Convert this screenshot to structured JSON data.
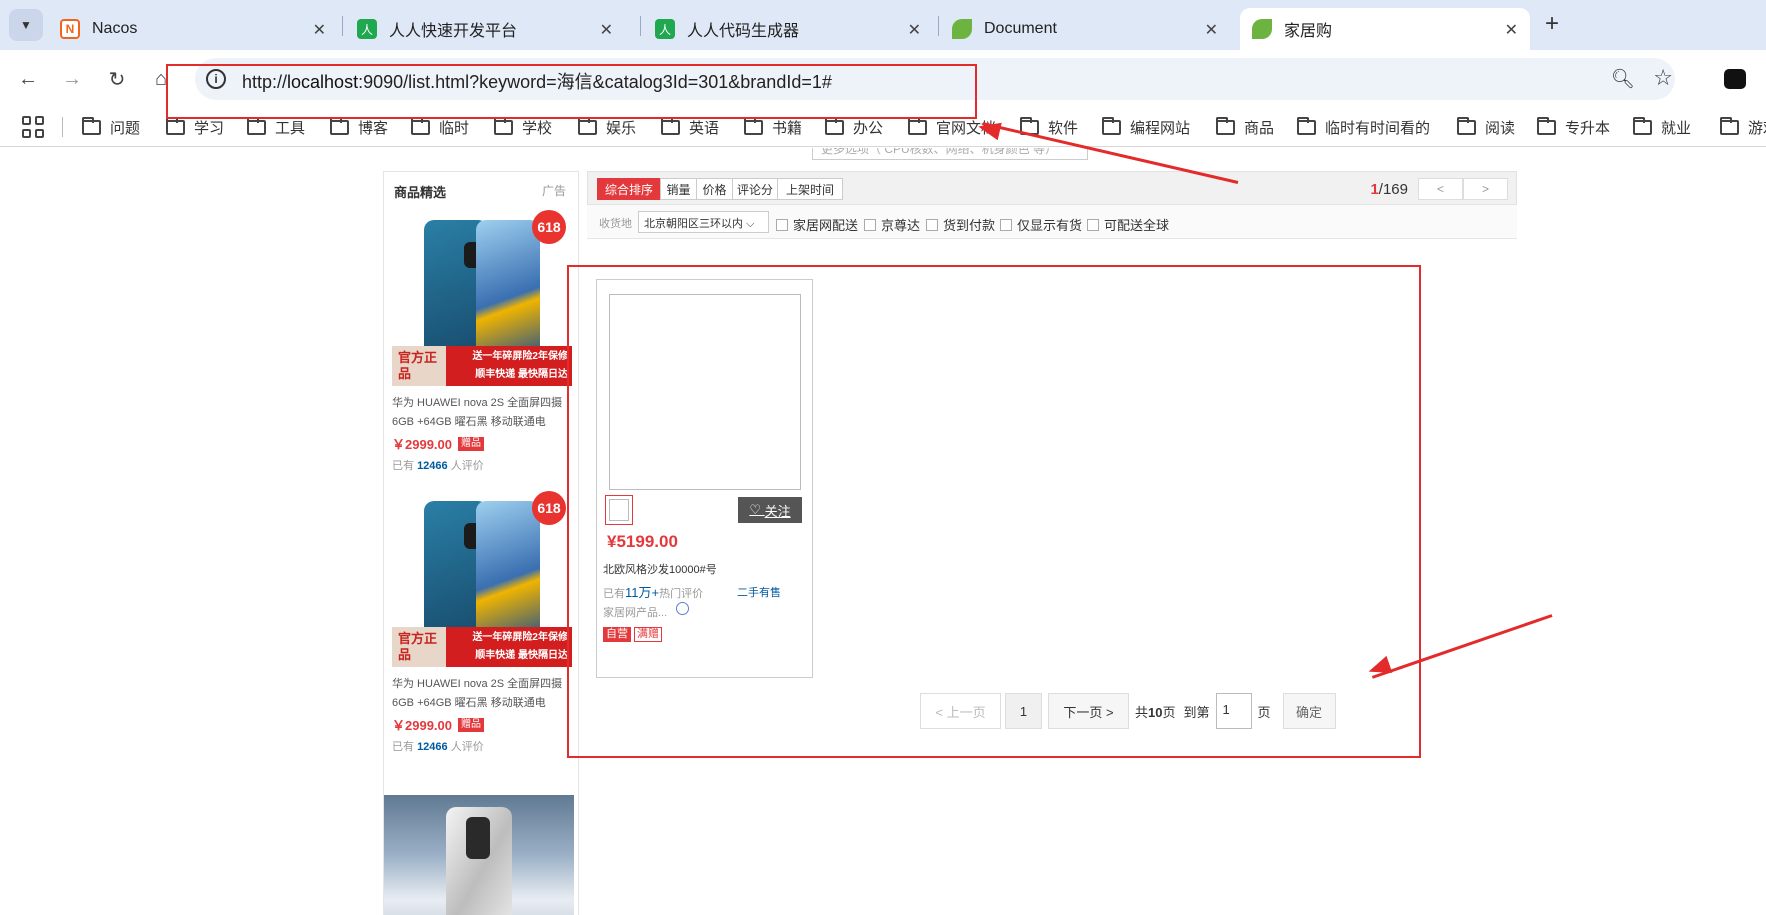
{
  "tabs": [
    {
      "title": "Nacos",
      "icon": "nacos-icon",
      "color": "#f0651d"
    },
    {
      "title": "人人快速开发平台",
      "icon": "renren-icon",
      "color": "#1fa84f"
    },
    {
      "title": "人人代码生成器",
      "icon": "renren-icon",
      "color": "#1fa84f"
    },
    {
      "title": "Document",
      "icon": "spring-leaf-icon",
      "color": "#6db33f"
    },
    {
      "title": "家居购",
      "icon": "spring-leaf-icon",
      "color": "#6db33f",
      "active": true
    }
  ],
  "address": {
    "protocol": "http://",
    "host": "localhost",
    "rest": ":9090/list.html?keyword=海信&catalog3Id=301&brandId=1#"
  },
  "bookmarks": [
    "问题",
    "学习",
    "工具",
    "博客",
    "临时",
    "学校",
    "娱乐",
    "英语",
    "书籍",
    "办公",
    "官网文档",
    "软件",
    "编程网站",
    "商品",
    "临时有时间看的",
    "阅读",
    "专升本",
    "就业",
    "游戏"
  ],
  "search_hint": "更多选项（ CPU核数、网络、机身颜色 等）",
  "sidebar": {
    "heading": "商品精选",
    "ad_label": "广告",
    "promos": [
      {
        "badge": "618",
        "banner_left": "官方正品",
        "banner_right_1": "送一年碎屏险2年保修",
        "banner_right_2": "顺丰快递 最快隔日达",
        "title": "华为 HUAWEI nova 2S 全面屏四摄 6GB +64GB 曜石黑 移动联通电",
        "price": "￥2999.00",
        "gift": "赠品",
        "reviews_pre": "已有",
        "reviews_count": "12466",
        "reviews_post": "人评价"
      },
      {
        "badge": "618",
        "banner_left": "官方正品",
        "banner_right_1": "送一年碎屏险2年保修",
        "banner_right_2": "顺丰快递 最快隔日达",
        "title": "华为 HUAWEI nova 2S 全面屏四摄 6GB +64GB 曜石黑 移动联通电",
        "price": "￥2999.00",
        "gift": "赠品",
        "reviews_pre": "已有",
        "reviews_count": "12466",
        "reviews_post": "人评价"
      }
    ]
  },
  "sort": {
    "options": [
      "综合排序",
      "销量",
      "价格",
      "评论分",
      "上架时间"
    ],
    "active": "综合排序"
  },
  "mini_pager": {
    "current": "1",
    "total": "/169",
    "prev": "<",
    "next": ">"
  },
  "filters": {
    "location_label": "收货地",
    "location_value": "北京朝阳区三环以内",
    "checkboxes": [
      "家居网配送",
      "京尊达",
      "货到付款",
      "仅显示有货",
      "可配送全球"
    ]
  },
  "product": {
    "price": "¥5199.00",
    "name": "北欧风格沙发10000#号",
    "reviews_pre": "已有",
    "reviews_count": "11万+",
    "reviews_post": "热门评价",
    "second_hand": "二手有售",
    "shop": "家居网产品...",
    "follow": "关注",
    "tags": [
      "自营",
      "满赠"
    ]
  },
  "pagination": {
    "prev": "< 上一页",
    "page": "1",
    "next": "下一页 >",
    "total_pre": "共",
    "total_pages": "10",
    "total_post": "页",
    "goto_label": "到第",
    "goto_value": "1",
    "goto_unit": "页",
    "confirm": "确定"
  },
  "colors": {
    "accent": "#e4393c",
    "annotation": "#e32b2b",
    "link": "#005aa0"
  }
}
